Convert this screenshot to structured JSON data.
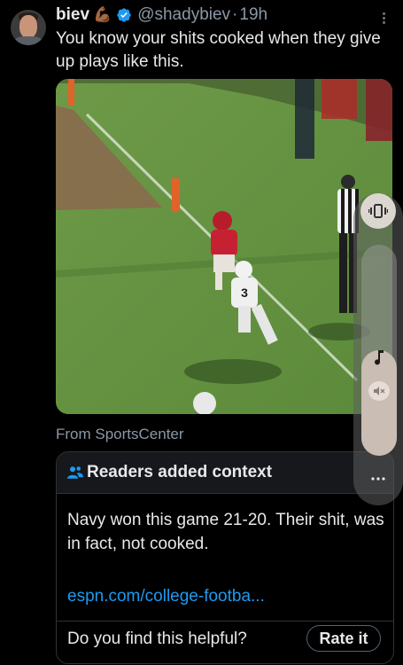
{
  "tweet": {
    "author_name": "biev",
    "author_emoji": "💪🏾",
    "handle": "@shadybiev",
    "separator": "·",
    "time": "19h",
    "text": "You know your shits cooked when they give up plays like this."
  },
  "media": {
    "source": "From SportsCenter",
    "jersey_number": "3"
  },
  "community_note": {
    "title": "Readers added context",
    "body": "Navy won this game 21-20. Their shit, was in fact, not cooked.",
    "link": "espn.com/college-footba...",
    "question": "Do you find this helpful?",
    "rate_label": "Rate it"
  },
  "volume_overlay": {
    "level": 0.5
  },
  "colors": {
    "background": "#000000",
    "text": "#e7e9ea",
    "secondary": "#8b98a5",
    "link": "#1d9bf0",
    "verified": "#1d9bf0",
    "border": "#2f3336"
  },
  "icons": {
    "verified": "verified-badge-icon",
    "more": "more-kebab-icon",
    "people": "people-icon",
    "vibrate": "vibrate-icon",
    "music": "music-note-icon",
    "mute": "speaker-mute-icon",
    "panel_more": "more-dots-icon"
  }
}
